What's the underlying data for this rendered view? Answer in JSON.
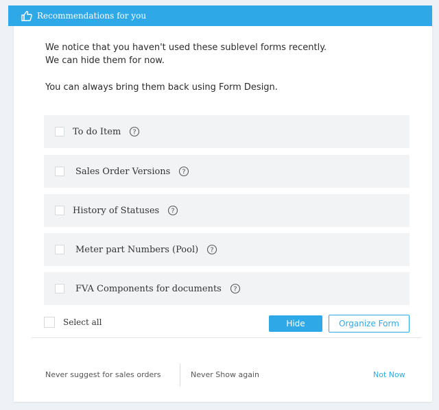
{
  "header": {
    "title": "Recommendations for you",
    "icon": "thumbs-up-icon",
    "color": "#2ea8e6"
  },
  "intro": {
    "line1": "We notice that you haven't used these sublevel forms recently.",
    "line2": "We can hide them for now.",
    "line3": "You can always bring them back using Form Design."
  },
  "items": [
    {
      "label": "To do Item",
      "checked": false
    },
    {
      "label": "Sales Order Versions",
      "checked": false
    },
    {
      "label": "History of Statuses",
      "checked": false
    },
    {
      "label": "Meter part Numbers (Pool)",
      "checked": false
    },
    {
      "label": "FVA Components for documents",
      "checked": false
    }
  ],
  "select_all": {
    "label": "Select all",
    "checked": false
  },
  "buttons": {
    "hide": "Hide",
    "organize": "Organize Form"
  },
  "footer": {
    "never_suggest": "Never suggest for sales orders",
    "never_show": "Never Show again",
    "not_now": "Not Now"
  }
}
